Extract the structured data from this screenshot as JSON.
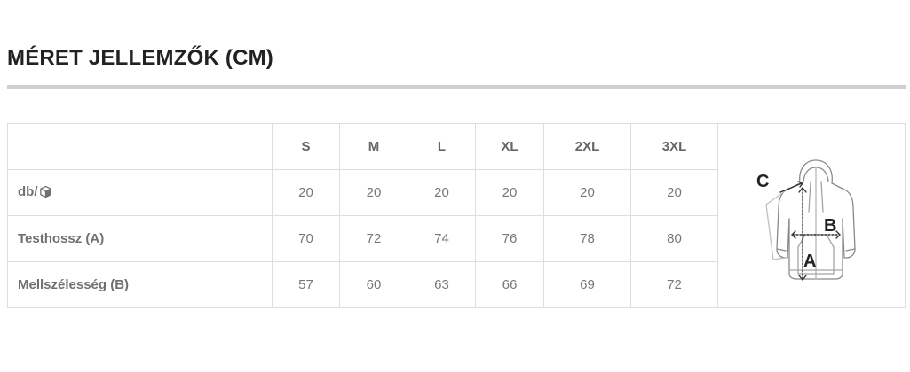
{
  "title": "MÉRET JELLEMZŐK (CM)",
  "table": {
    "columns": [
      "S",
      "M",
      "L",
      "XL",
      "2XL",
      "3XL"
    ],
    "rows": [
      {
        "label": "db/",
        "icon": "box-icon",
        "values": [
          "20",
          "20",
          "20",
          "20",
          "20",
          "20"
        ]
      },
      {
        "label": "Testhossz (A)",
        "values": [
          "70",
          "72",
          "74",
          "76",
          "78",
          "80"
        ]
      },
      {
        "label": "Mellszélesség (B)",
        "values": [
          "57",
          "60",
          "63",
          "66",
          "69",
          "72"
        ]
      }
    ]
  },
  "illustration": {
    "icon": "hoodie-measurement-icon",
    "labels": {
      "a": "A",
      "b": "B",
      "c": "C"
    },
    "colors": {
      "garment": "#8a8a8a",
      "letters": "#222222"
    }
  }
}
